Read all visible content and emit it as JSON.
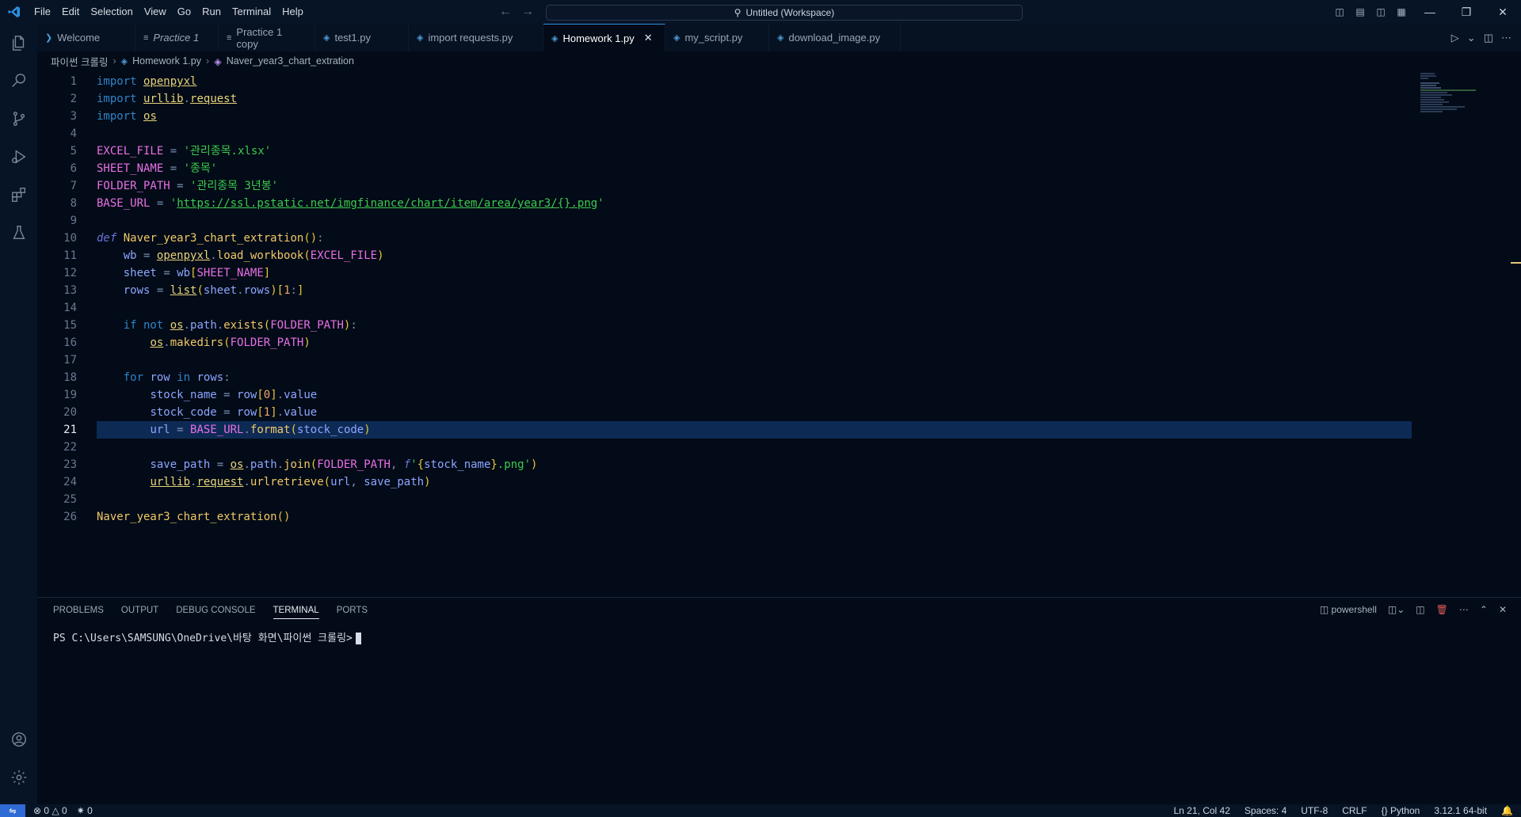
{
  "menu": [
    "File",
    "Edit",
    "Selection",
    "View",
    "Go",
    "Run",
    "Terminal",
    "Help"
  ],
  "command_center": "Untitled (Workspace)",
  "tabs": [
    {
      "label": "Welcome"
    },
    {
      "label": "Practice 1"
    },
    {
      "label": "Practice 1 copy"
    },
    {
      "label": "test1.py"
    },
    {
      "label": "import requests.py"
    },
    {
      "label": "Homework 1.py"
    },
    {
      "label": "my_script.py"
    },
    {
      "label": "download_image.py"
    }
  ],
  "breadcrumb": {
    "folder": "파이썬 크롤링",
    "file": "Homework 1.py",
    "symbol": "Naver_year3_chart_extration"
  },
  "code_lines": [
    "import openpyxl",
    "import urllib.request",
    "import os",
    "",
    "EXCEL_FILE = '관리종목.xlsx'",
    "SHEET_NAME = '종목'",
    "FOLDER_PATH = '관리종목 3년봉'",
    "BASE_URL = 'https://ssl.pstatic.net/imgfinance/chart/item/area/year3/{}.png'",
    "",
    "def Naver_year3_chart_extration():",
    "    wb = openpyxl.load_workbook(EXCEL_FILE)",
    "    sheet = wb[SHEET_NAME]",
    "    rows = list(sheet.rows)[1:]",
    "",
    "    if not os.path.exists(FOLDER_PATH):",
    "        os.makedirs(FOLDER_PATH)",
    "",
    "    for row in rows:",
    "        stock_name = row[0].value",
    "        stock_code = row[1].value",
    "        url = BASE_URL.format(stock_code)",
    "",
    "        save_path = os.path.join(FOLDER_PATH, f'{stock_name}.png')",
    "        urllib.request.urlretrieve(url, save_path)",
    "",
    "Naver_year3_chart_extration()"
  ],
  "line_numbers": [
    "1",
    "2",
    "3",
    "4",
    "5",
    "6",
    "7",
    "8",
    "9",
    "10",
    "11",
    "12",
    "13",
    "14",
    "15",
    "16",
    "17",
    "18",
    "19",
    "20",
    "21",
    "22",
    "23",
    "24",
    "25",
    "26"
  ],
  "current_line": 21,
  "panel": {
    "tabs": [
      "PROBLEMS",
      "OUTPUT",
      "DEBUG CONSOLE",
      "TERMINAL",
      "PORTS"
    ],
    "active_tab": "TERMINAL",
    "shell": "powershell",
    "prompt": "PS C:\\Users\\SAMSUNG\\OneDrive\\바탕 화면\\파이썬 크롤링>"
  },
  "status": {
    "errors": "0",
    "warnings": "0",
    "ports": "0",
    "position": "Ln 21, Col 42",
    "spaces": "Spaces: 4",
    "encoding": "UTF-8",
    "eol": "CRLF",
    "language": "Python",
    "interpreter": "3.12.1 64-bit"
  },
  "colors": {
    "accent": "#2d8fe0",
    "background": "#020b17",
    "current_line": "#0d2a55"
  },
  "icons": [
    "explorer-icon",
    "search-icon",
    "source-control-icon",
    "run-debug-icon",
    "extensions-icon",
    "testing-icon",
    "accounts-icon",
    "settings-icon"
  ]
}
